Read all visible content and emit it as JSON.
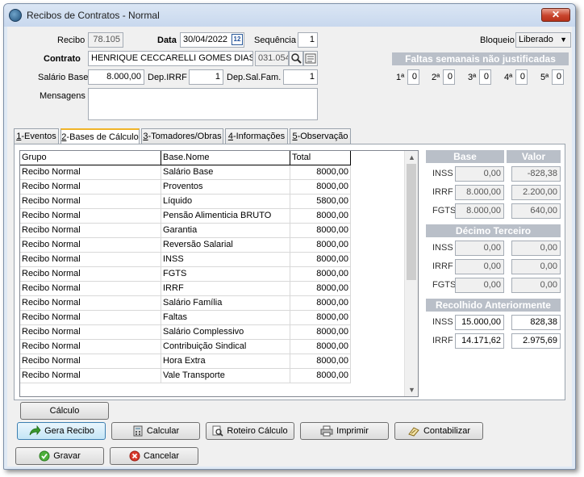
{
  "window": {
    "title": "Recibos de Contratos - Normal",
    "close_label": "✕"
  },
  "header": {
    "recibo_label": "Recibo",
    "recibo_value": "78.105",
    "data_label": "Data",
    "data_value": "30/04/2022",
    "sequencia_label": "Sequência",
    "sequencia_value": "1",
    "bloqueio_label": "Bloqueio",
    "bloqueio_value": "Liberado",
    "contrato_label": "Contrato",
    "contrato_name": "HENRIQUE CECCARELLI GOMES DIAS",
    "contrato_code": "031.054",
    "salario_label": "Salário Base",
    "salario_value": "8.000,00",
    "depirrf_label": "Dep.IRRF",
    "depirrf_value": "1",
    "depsalfam_label": "Dep.Sal.Fam.",
    "depsalfam_value": "1",
    "mensagens_label": "Mensagens",
    "mensagens_value": "",
    "faltas_title": "Faltas semanais não justificadas",
    "faltas": [
      {
        "label": "1ª",
        "value": "0"
      },
      {
        "label": "2ª",
        "value": "0"
      },
      {
        "label": "3ª",
        "value": "0"
      },
      {
        "label": "4ª",
        "value": "0"
      },
      {
        "label": "5ª",
        "value": "0"
      }
    ]
  },
  "tabs": [
    {
      "key": "1",
      "rest": "-Eventos"
    },
    {
      "key": "2",
      "rest": "-Bases de Cálculo"
    },
    {
      "key": "3",
      "rest": "-Tomadores/Obras"
    },
    {
      "key": "4",
      "rest": "-Informações"
    },
    {
      "key": "5",
      "rest": "-Observação"
    }
  ],
  "grid": {
    "columns": [
      "Grupo",
      "Base.Nome",
      "Total"
    ],
    "rows": [
      [
        "Recibo Normal",
        "Salário Base",
        "8000,00"
      ],
      [
        "Recibo Normal",
        "Proventos",
        "8000,00"
      ],
      [
        "Recibo Normal",
        "Líquido",
        "5800,00"
      ],
      [
        "Recibo Normal",
        "Pensão Alimenticia BRUTO",
        "8000,00"
      ],
      [
        "Recibo Normal",
        "Garantia",
        "8000,00"
      ],
      [
        "Recibo Normal",
        "Reversão Salarial",
        "8000,00"
      ],
      [
        "Recibo Normal",
        "INSS",
        "8000,00"
      ],
      [
        "Recibo Normal",
        "FGTS",
        "8000,00"
      ],
      [
        "Recibo Normal",
        "IRRF",
        "8000,00"
      ],
      [
        "Recibo Normal",
        "Salário Família",
        "8000,00"
      ],
      [
        "Recibo Normal",
        "Faltas",
        "8000,00"
      ],
      [
        "Recibo Normal",
        "Salário Complessivo",
        "8000,00"
      ],
      [
        "Recibo Normal",
        "Contribuição Sindical",
        "8000,00"
      ],
      [
        "Recibo Normal",
        "Hora Extra",
        "8000,00"
      ],
      [
        "Recibo Normal",
        "Vale Transporte",
        "8000,00"
      ]
    ]
  },
  "right_panel": {
    "base_header": "Base",
    "valor_header": "Valor",
    "main": [
      {
        "label": "INSS",
        "base": "0,00",
        "valor": "-828,38"
      },
      {
        "label": "IRRF",
        "base": "8.000,00",
        "valor": "2.200,00"
      },
      {
        "label": "FGTS",
        "base": "8.000,00",
        "valor": "640,00"
      }
    ],
    "decimo_title": "Décimo Terceiro",
    "decimo": [
      {
        "label": "INSS",
        "base": "0,00",
        "valor": "0,00"
      },
      {
        "label": "IRRF",
        "base": "0,00",
        "valor": "0,00"
      },
      {
        "label": "FGTS",
        "base": "0,00",
        "valor": "0,00"
      }
    ],
    "recolhido_title": "Recolhido Anteriormente",
    "recolhido": [
      {
        "label": "INSS",
        "base": "15.000,00",
        "valor": "828,38"
      },
      {
        "label": "IRRF",
        "base": "14.171,62",
        "valor": "2.975,69"
      }
    ]
  },
  "buttons": {
    "calculo": "Cálculo",
    "gera_recibo": "Gera Recibo",
    "calcular": "Calcular",
    "roteiro": "Roteiro Cálculo",
    "imprimir": "Imprimir",
    "contabilizar": "Contabilizar",
    "gravar": "Gravar",
    "cancelar": "Cancelar"
  }
}
